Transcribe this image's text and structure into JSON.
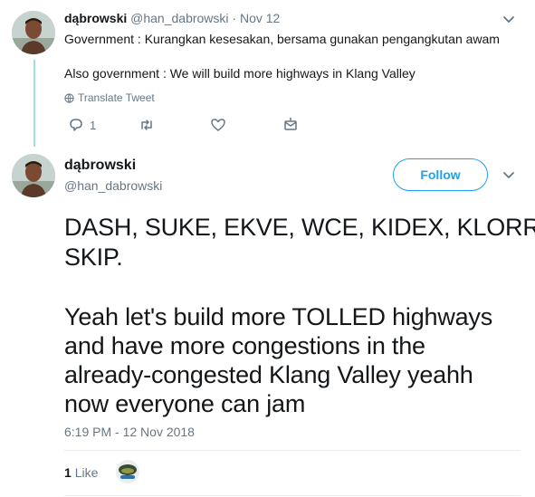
{
  "parent_tweet": {
    "display_name": "dąbrowski",
    "handle": "@han_dabrowski",
    "separator": "·",
    "date": "Nov 12",
    "line1": "Government : Kurangkan kesesakan, bersama gunakan pengangkutan awam",
    "line2": "Also government : We will build more highways in Klang Valley",
    "translate_label": "Translate Tweet",
    "reply_count": "1",
    "icons": {
      "menu": "chevron-down-icon",
      "translate": "globe-icon",
      "reply": "reply-icon",
      "retweet": "retweet-icon",
      "like": "heart-icon",
      "dm": "envelope-icon"
    }
  },
  "main_tweet": {
    "display_name": "dąbrowski",
    "handle": "@han_dabrowski",
    "follow_label": "Follow",
    "text_lines": [
      "DASH, SUKE, EKVE, WCE, KIDEX, KLORR,",
      "SKIP.",
      "",
      "Yeah let's build more TOLLED highways",
      "and have more congestions in the",
      "already-congested Klang Valley yeahh",
      "now everyone can jam"
    ],
    "timestamp": "6:19 PM - 12 Nov 2018",
    "like_count": "1",
    "like_label": "Like"
  },
  "colors": {
    "accent": "#1da1f2",
    "muted": "#657786",
    "text": "#14171a",
    "thread_line": "#9fdfdb",
    "divider": "#e6ecf0"
  }
}
